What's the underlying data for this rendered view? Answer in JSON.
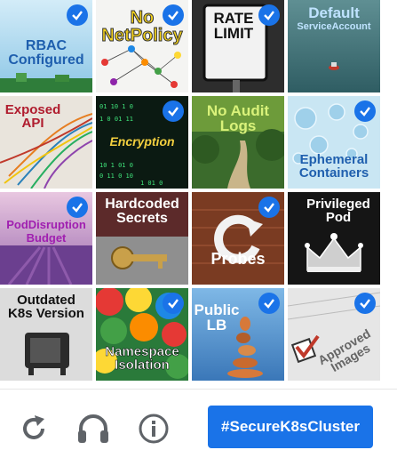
{
  "tiles": [
    {
      "label": "RBAC\nConfigured",
      "checked": true
    },
    {
      "label": "No\nNetPolicy",
      "checked": true
    },
    {
      "label": "RATE\nLIMIT",
      "checked": true
    },
    {
      "label": "Default",
      "sub": "ServiceAccount",
      "checked": false
    },
    {
      "label": "Exposed\nAPI",
      "checked": false
    },
    {
      "label": "Encryption",
      "checked": true
    },
    {
      "label": "No Audit\nLogs",
      "checked": false
    },
    {
      "label": "Ephemeral\nContainers",
      "checked": true
    },
    {
      "label": "PodDisruption",
      "sub": "Budget",
      "checked": true
    },
    {
      "label": "Hardcoded\nSecrets",
      "checked": false
    },
    {
      "label": "Probes",
      "checked": true
    },
    {
      "label": "Privileged\nPod",
      "checked": false
    },
    {
      "label": "Outdated\nK8s Version",
      "checked": false
    },
    {
      "label": "Namespace\nIsolation",
      "checked": true
    },
    {
      "label": "Public\nLB",
      "checked": true
    },
    {
      "label": "Approved\nImages",
      "checked": true
    }
  ],
  "footer": {
    "reload_icon": "reload-icon",
    "audio_icon": "headphones-icon",
    "info_icon": "info-icon",
    "verify_label": "#SecureK8sCluster"
  },
  "colors": {
    "accent": "#1a73e8"
  }
}
